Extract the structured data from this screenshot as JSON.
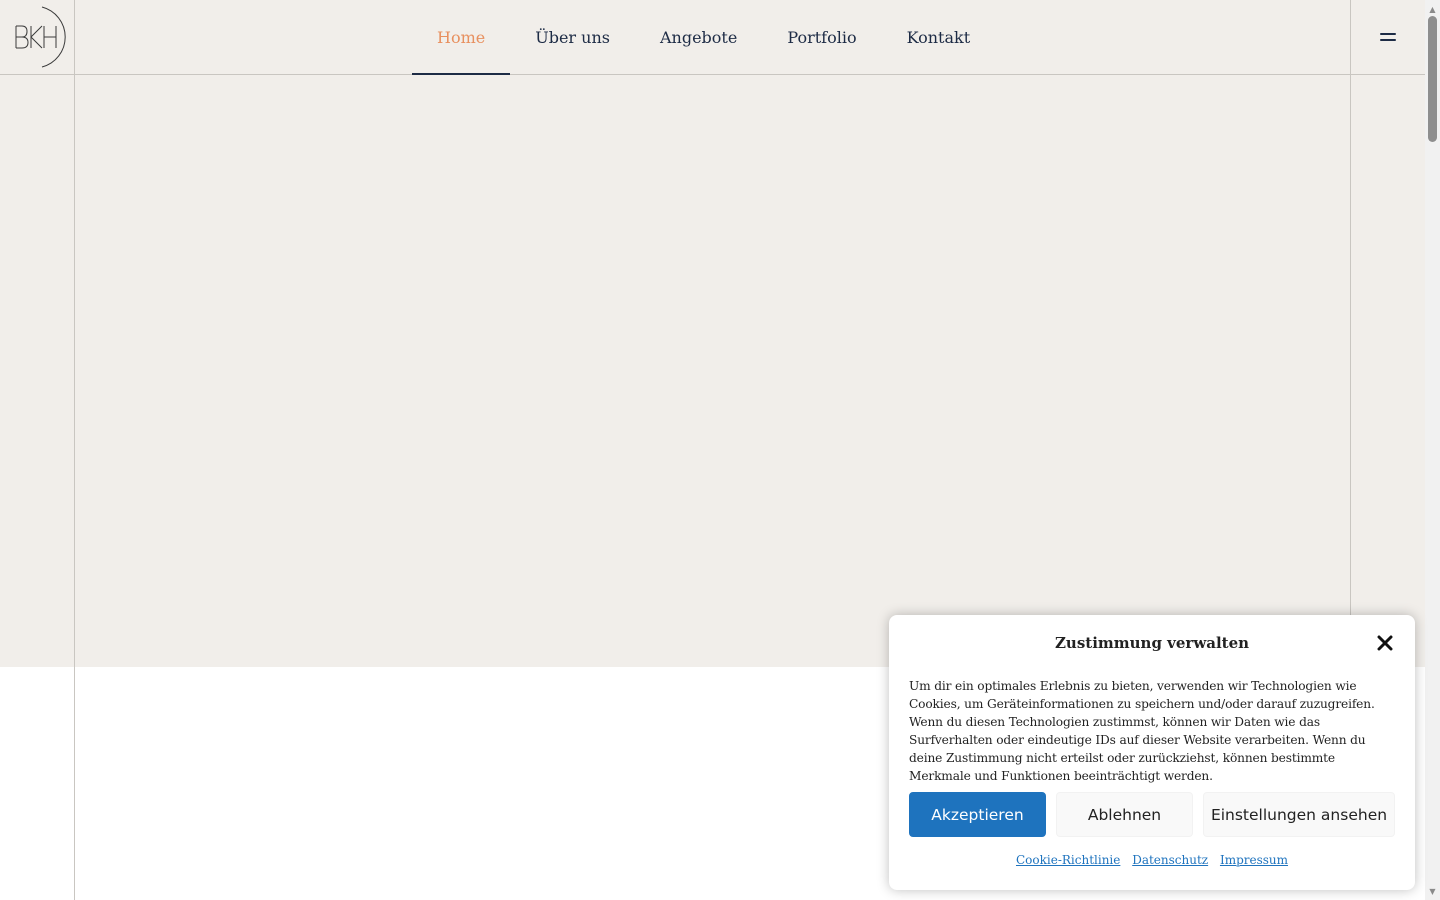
{
  "header": {
    "logo_alt": "BKH",
    "nav": [
      {
        "label": "Home",
        "active": true
      },
      {
        "label": "Über uns",
        "active": false
      },
      {
        "label": "Angebote",
        "active": false
      },
      {
        "label": "Portfolio",
        "active": false
      },
      {
        "label": "Kontakt",
        "active": false
      }
    ],
    "menu_icon": "hamburger-icon"
  },
  "cookie_banner": {
    "title": "Zustimmung verwalten",
    "close_icon": "close-icon",
    "text": "Um dir ein optimales Erlebnis zu bieten, verwenden wir Technologien wie Cookies, um Geräteinformationen zu speichern und/oder darauf zuzugreifen. Wenn du diesen Technologien zustimmst, können wir Daten wie das Surfverhalten oder eindeutige IDs auf dieser Website verarbeiten. Wenn du deine Zustimmung nicht erteilst oder zurückziehst, können bestimmte Merkmale und Funktionen beeinträchtigt werden.",
    "buttons": {
      "accept": "Akzeptieren",
      "deny": "Ablehnen",
      "settings": "Einstellungen ansehen"
    },
    "links": {
      "cookie_policy": "Cookie-Richtlinie",
      "privacy": "Datenschutz",
      "imprint": "Impressum"
    }
  },
  "colors": {
    "hero_background": "#f1eeea",
    "nav_text": "#1d2b45",
    "nav_active": "#e8905f",
    "accept_button": "#1e73be",
    "link": "#1e73be"
  }
}
